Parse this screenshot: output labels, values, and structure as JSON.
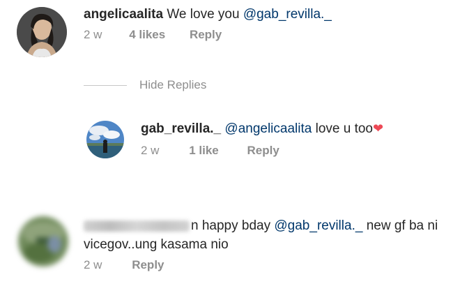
{
  "comments": [
    {
      "username": "angelicaalita",
      "text_before": "We love you",
      "mention": "@gab_revilla._",
      "text_after": "",
      "time": "2 w",
      "likes": "4 likes",
      "reply": "Reply"
    }
  ],
  "hide_replies": "Hide Replies",
  "reply_comment": {
    "username": "gab_revilla._",
    "mention": "@angelicaalita",
    "text_after": "love u too",
    "heart": "❤",
    "time": "2 w",
    "likes": "1 like",
    "reply": "Reply"
  },
  "third_comment": {
    "username_blurred": "tanganamanan",
    "username_tail": "n",
    "text_before": "happy bday",
    "mention": "@gab_revilla._",
    "text_after": "new gf ba ni",
    "line2": "vicegov..ung kasama nio",
    "time": "2 w",
    "reply": "Reply"
  },
  "colors": {
    "mention": "#00376b",
    "meta": "#8e8e8e",
    "heart": "#ed4956"
  }
}
